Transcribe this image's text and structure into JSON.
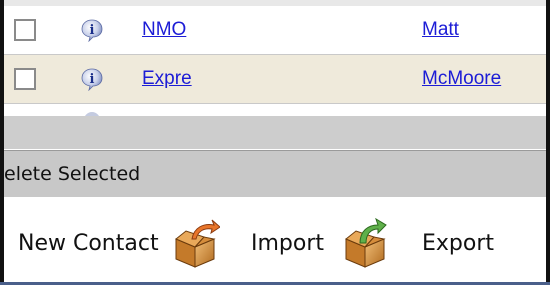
{
  "rows": [
    {
      "name": "NMO",
      "owner": "Matt"
    },
    {
      "name": "Expre",
      "owner": "McMoore"
    }
  ],
  "actions": {
    "delete_selected": "elete Selected",
    "new_contact": "New Contact",
    "import": "Import",
    "export": "Export"
  },
  "icons": {
    "info": "info-icon",
    "import": "box-arrow-in-icon",
    "export": "box-arrow-out-icon"
  },
  "colors": {
    "link": "#1c1cd6",
    "row_alt": "#efeadb",
    "toolbar_band": "#c8c8c8"
  }
}
